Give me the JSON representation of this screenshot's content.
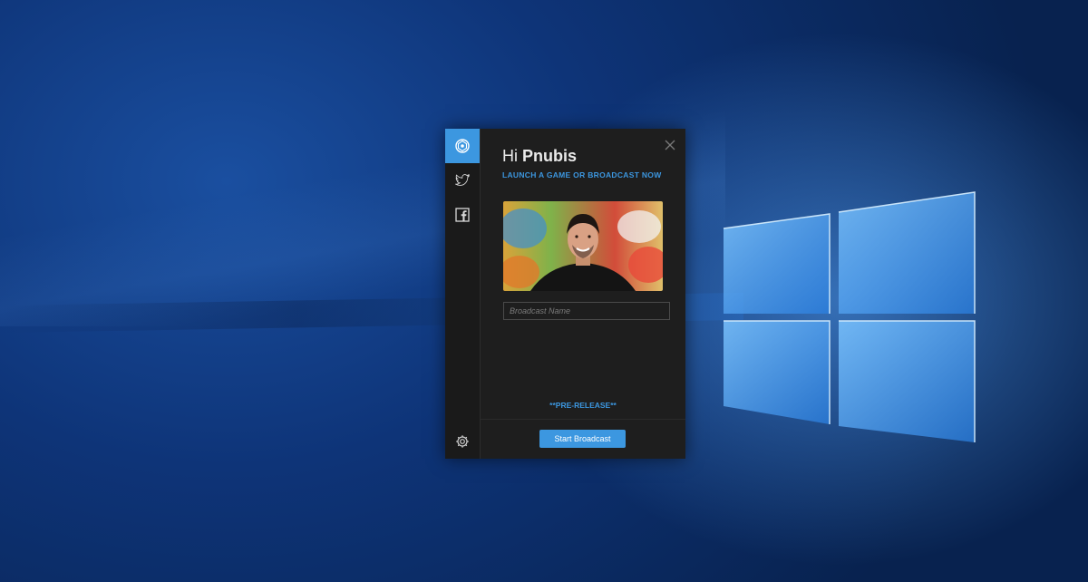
{
  "app": {
    "greeting_prefix": "Hi",
    "username": "Pnubis",
    "subtitle": "LAUNCH A GAME OR BROADCAST NOW",
    "broadcast_name_placeholder": "Broadcast Name",
    "broadcast_name_value": "",
    "prerelease_label": "**PRE-RELEASE**",
    "start_button_label": "Start Broadcast",
    "accent_color": "#3c97e0"
  },
  "rail": {
    "items": [
      {
        "icon": "app-logo-icon",
        "active": true
      },
      {
        "icon": "twitter-icon",
        "active": false
      },
      {
        "icon": "facebook-icon",
        "active": false
      }
    ],
    "bottom_icon": "gear-icon"
  }
}
